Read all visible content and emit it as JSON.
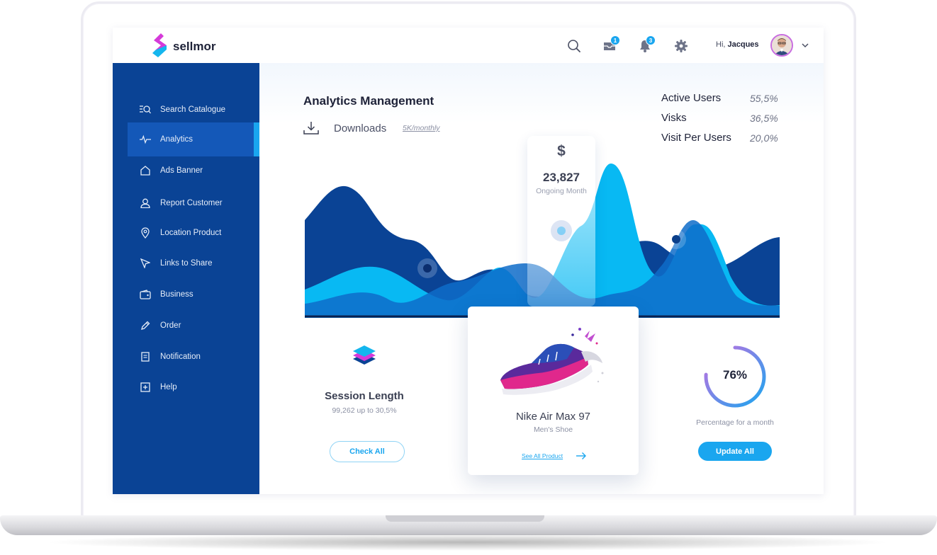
{
  "app": {
    "brand": "sellmor"
  },
  "header": {
    "greeting_prefix": "Hi,",
    "user_name": "Jacques",
    "messages_count": "1",
    "notifications_count": "3"
  },
  "sidebar": {
    "items": [
      {
        "label": "Search Catalogue",
        "icon": "search-catalogue-icon"
      },
      {
        "label": "Analytics",
        "icon": "analytics-icon",
        "active": true
      },
      {
        "label": "Ads Banner",
        "icon": "home-icon"
      },
      {
        "label": "Report Customer",
        "icon": "user-icon"
      },
      {
        "label": "Location Product",
        "icon": "location-pin-icon"
      },
      {
        "label": "Links to Share",
        "icon": "cursor-icon"
      },
      {
        "label": "Business",
        "icon": "wallet-icon"
      },
      {
        "label": "Order",
        "icon": "pencil-icon"
      },
      {
        "label": "Notification",
        "icon": "document-icon"
      },
      {
        "label": "Help",
        "icon": "plus-square-icon"
      }
    ]
  },
  "main": {
    "title": "Analytics Management",
    "downloads_label": "Downloads",
    "downloads_rate": "5K/monthly",
    "stats": [
      {
        "label": "Active Users",
        "value": "55,5%"
      },
      {
        "label": "Visks",
        "value": "36,5%"
      },
      {
        "label": "Visit Per Users",
        "value": "20,0%"
      }
    ],
    "highlight": {
      "symbol": "$",
      "value": "23,827",
      "caption": "Ongoing Month"
    }
  },
  "cards": {
    "session": {
      "title": "Session Length",
      "subtitle": "99,262 up to 30,5%",
      "button": "Check All"
    },
    "product": {
      "name": "Nike Air Max 97",
      "category": "Men's Shoe",
      "link": "See All Product"
    },
    "progress": {
      "value_label": "76%",
      "value": 0.76,
      "caption": "Percentage for a month",
      "button": "Update All"
    }
  },
  "colors": {
    "sidebar": "#0a4395",
    "sidebar_active": "#1458b8",
    "accent": "#1aa6ef",
    "dark_wave": "#0a4395",
    "mid_wave": "#0e6cc9",
    "light_wave": "#08b9f3"
  }
}
